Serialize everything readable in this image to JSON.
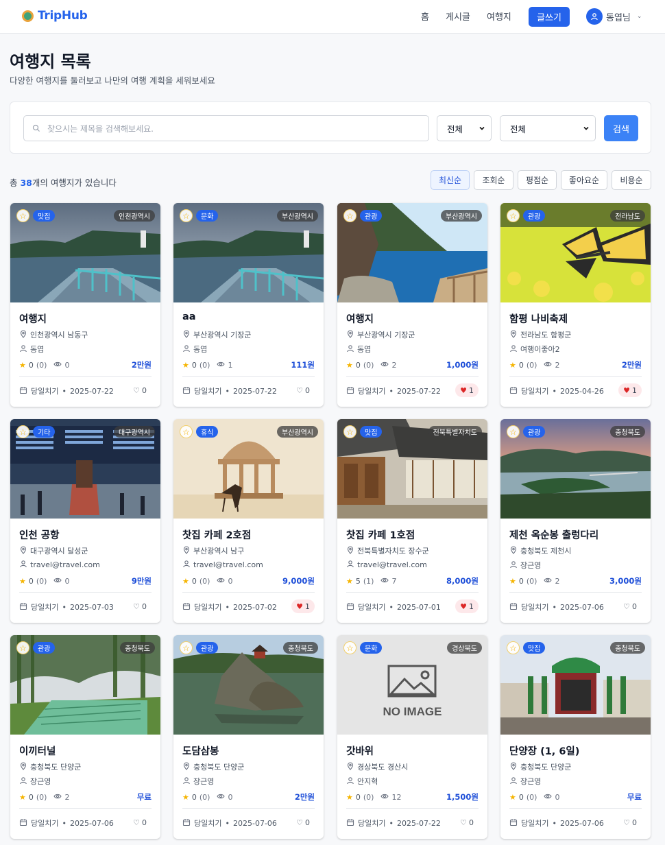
{
  "header": {
    "brand": "TripHub",
    "nav": [
      "홈",
      "게시글",
      "여행지"
    ],
    "write_label": "글쓰기",
    "user_name": "동엽님"
  },
  "page": {
    "title": "여행지 목록",
    "subtitle": "다양한 여행지를 둘러보고 나만의 여행 계획을 세워보세요"
  },
  "search": {
    "placeholder": "찾으시는 제목을 검색해보세요.",
    "filter1": "전체",
    "filter2": "전체",
    "button": "검색"
  },
  "summary": {
    "prefix": "총 ",
    "count": "38",
    "suffix": "개의 여행지가 있습니다"
  },
  "sort": {
    "options": [
      "최신순",
      "조회순",
      "평점순",
      "좋아요순",
      "비용순"
    ],
    "active": "최신순"
  },
  "cards": [
    {
      "category": "맛집",
      "region": "인천광역시",
      "title": "여행지",
      "location": "인천광역시 남동구",
      "author": "동엽",
      "rating": "0",
      "reviews": "(0)",
      "views": "0",
      "price": "2만원",
      "duration": "당일치기",
      "date": "2025-07-22",
      "likes": "0",
      "liked": false,
      "image": "boardwalk"
    },
    {
      "category": "문화",
      "region": "부산광역시",
      "title": "aa",
      "location": "부산광역시 기장군",
      "author": "동엽",
      "rating": "0",
      "reviews": "(0)",
      "views": "1",
      "price": "111원",
      "duration": "당일치기",
      "date": "2025-07-22",
      "likes": "0",
      "liked": false,
      "image": "boardwalk"
    },
    {
      "category": "관광",
      "region": "부산광역시",
      "title": "여행지",
      "location": "부산광역시 기장군",
      "author": "동엽",
      "rating": "0",
      "reviews": "(0)",
      "views": "2",
      "price": "1,000원",
      "duration": "당일치기",
      "date": "2025-07-22",
      "likes": "1",
      "liked": true,
      "image": "coast"
    },
    {
      "category": "관광",
      "region": "전라남도",
      "title": "함평 나비축제",
      "location": "전라남도 함평군",
      "author": "여행이좋아2",
      "rating": "0",
      "reviews": "(0)",
      "views": "2",
      "price": "2만원",
      "duration": "당일치기",
      "date": "2025-04-26",
      "likes": "1",
      "liked": true,
      "image": "butterfly"
    },
    {
      "category": "기타",
      "region": "대구광역시",
      "title": "인천 공항",
      "location": "대구광역시 달성군",
      "author": "travel@travel.com",
      "rating": "0",
      "reviews": "(0)",
      "views": "0",
      "price": "9만원",
      "duration": "당일치기",
      "date": "2025-07-03",
      "likes": "0",
      "liked": false,
      "image": "airport"
    },
    {
      "category": "휴식",
      "region": "부산광역시",
      "title": "찻집 카페 2호점",
      "location": "부산광역시 남구",
      "author": "travel@travel.com",
      "rating": "0",
      "reviews": "(0)",
      "views": "0",
      "price": "9,000원",
      "duration": "당일치기",
      "date": "2025-07-02",
      "likes": "1",
      "liked": true,
      "image": "pavilion"
    },
    {
      "category": "맛집",
      "region": "전북특별자치도",
      "title": "찻집 카페 1호점",
      "location": "전북특별자치도 장수군",
      "author": "travel@travel.com",
      "rating": "5",
      "reviews": "(1)",
      "views": "7",
      "price": "8,000원",
      "duration": "당일치기",
      "date": "2025-07-01",
      "likes": "1",
      "liked": true,
      "image": "hanok"
    },
    {
      "category": "관광",
      "region": "충청북도",
      "title": "제천 옥순봉 출렁다리",
      "location": "충청북도 제천시",
      "author": "장근영",
      "rating": "0",
      "reviews": "(0)",
      "views": "2",
      "price": "3,000원",
      "duration": "당일치기",
      "date": "2025-07-06",
      "likes": "0",
      "liked": false,
      "image": "sunset"
    },
    {
      "category": "관광",
      "region": "충청북도",
      "title": "이끼터널",
      "location": "충청북도 단양군",
      "author": "장근영",
      "rating": "0",
      "reviews": "(0)",
      "views": "2",
      "price": "무료",
      "duration": "당일치기",
      "date": "2025-07-06",
      "likes": "0",
      "liked": false,
      "image": "moss"
    },
    {
      "category": "관광",
      "region": "충청북도",
      "title": "도담삼봉",
      "location": "충청북도 단양군",
      "author": "장근영",
      "rating": "0",
      "reviews": "(0)",
      "views": "0",
      "price": "2만원",
      "duration": "당일치기",
      "date": "2025-07-06",
      "likes": "0",
      "liked": false,
      "image": "rocks"
    },
    {
      "category": "문화",
      "region": "경상북도",
      "title": "갓바위",
      "location": "경상북도 경산시",
      "author": "안지혁",
      "rating": "0",
      "reviews": "(0)",
      "views": "12",
      "price": "1,500원",
      "duration": "당일치기",
      "date": "2025-07-22",
      "likes": "0",
      "liked": false,
      "image": "noimage",
      "noimage_text": "NO IMAGE"
    },
    {
      "category": "맛집",
      "region": "충청북도",
      "title": "단양장 (1, 6일)",
      "location": "충청북도 단양군",
      "author": "장근영",
      "rating": "0",
      "reviews": "(0)",
      "views": "0",
      "price": "무료",
      "duration": "당일치기",
      "date": "2025-07-06",
      "likes": "0",
      "liked": false,
      "image": "market"
    }
  ],
  "colors": {
    "primary": "#2563eb",
    "price": "#1d4ed8",
    "star": "#f5b400",
    "heart": "#dc2626"
  }
}
